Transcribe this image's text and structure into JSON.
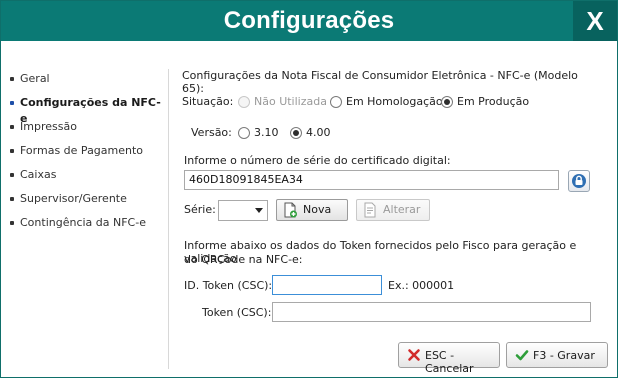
{
  "window": {
    "title": "Configurações",
    "close_glyph": "X"
  },
  "sidebar": {
    "items": [
      {
        "label": "Geral",
        "active": false
      },
      {
        "label": "Configurações da NFC-e",
        "active": true
      },
      {
        "label": "Impressão",
        "active": false
      },
      {
        "label": "Formas de Pagamento",
        "active": false
      },
      {
        "label": "Caixas",
        "active": false
      },
      {
        "label": "Supervisor/Gerente",
        "active": false
      },
      {
        "label": "Contingência da NFC-e",
        "active": false
      }
    ]
  },
  "nfce": {
    "heading": "Configurações da Nota Fiscal de Consumidor Eletrônica - NFC-e (Modelo 65):",
    "situacao": {
      "label": "Situação:",
      "options": [
        {
          "label": "Não Utilizada",
          "checked": false,
          "disabled": true
        },
        {
          "label": "Em Homologação",
          "checked": false,
          "disabled": false
        },
        {
          "label": "Em Produção",
          "checked": true,
          "disabled": false
        }
      ]
    },
    "versao": {
      "label": "Versão:",
      "options": [
        {
          "label": "3.10",
          "checked": false
        },
        {
          "label": "4.00",
          "checked": true
        }
      ]
    },
    "certificado": {
      "label": "Informe o número de série do certificado digital:",
      "value": "460D18091845EA34",
      "lock_icon": "lock-icon"
    },
    "serie": {
      "label": "Série:",
      "value": "",
      "nova_label": "Nova",
      "alterar_label": "Alterar",
      "nova_icon": "new-document-icon",
      "alterar_icon": "edit-document-icon"
    },
    "token": {
      "info_line1": "Informe abaixo os dados do Token fornecidos pelo Fisco para geração e validação",
      "info_line2": "do QRCode na NFC-e:",
      "id_label": "ID. Token (CSC):",
      "id_value": "",
      "id_example": "Ex.: 000001",
      "token_label": "Token (CSC):",
      "token_value": ""
    }
  },
  "footer": {
    "cancel_label": "ESC - Cancelar",
    "save_label": "F3 - Gravar",
    "cancel_icon": "x-icon",
    "save_icon": "check-icon"
  },
  "colors": {
    "titlebar": "#0b7a75",
    "close_bg": "#08625e",
    "cancel_x": "#d22b2b",
    "save_check": "#2e9e3a",
    "active_bullet": "#1e4fa8"
  }
}
